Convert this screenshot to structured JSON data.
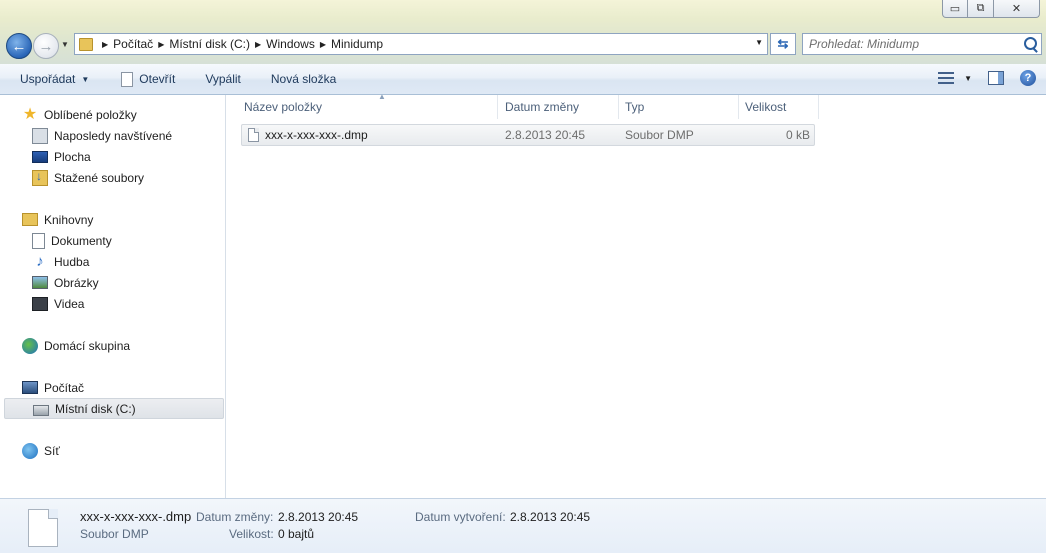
{
  "window": {
    "minimize_glyph": "▭",
    "maximize_glyph": "⧉",
    "close_glyph": "✕"
  },
  "nav": {
    "back_glyph": "←",
    "forward_glyph": "→",
    "recent_glyph": "▼"
  },
  "address": {
    "crumbs": [
      "Počítač",
      "Místní disk (C:)",
      "Windows",
      "Minidump"
    ]
  },
  "search": {
    "placeholder": "Prohledat: Minidump"
  },
  "toolbar": {
    "organize_label": "Uspořádat",
    "open_label": "Otevřít",
    "burn_label": "Vypálit",
    "new_folder_label": "Nová složka"
  },
  "navpane": {
    "favorites": "Oblíbené položky",
    "recent_places": "Naposledy navštívené",
    "desktop": "Plocha",
    "downloads": "Stažené soubory",
    "libraries": "Knihovny",
    "documents": "Dokumenty",
    "music": "Hudba",
    "pictures": "Obrázky",
    "videos": "Videa",
    "homegroup": "Domácí skupina",
    "computer": "Počítač",
    "local_disk": "Místní disk (C:)",
    "network": "Síť"
  },
  "columns": {
    "name": "Název položky",
    "date": "Datum změny",
    "type": "Typ",
    "size": "Velikost"
  },
  "files": [
    {
      "name": "xxx-x-xxx-xxx-.dmp",
      "date": "2.8.2013 20:45",
      "type": "Soubor DMP",
      "size": "0 kB"
    }
  ],
  "details": {
    "filename": "xxx-x-xxx-xxx-.dmp",
    "filetype": "Soubor DMP",
    "modified_label": "Datum změny:",
    "modified_value": "2.8.2013 20:45",
    "size_label": "Velikost:",
    "size_value": "0 bajtů",
    "created_label": "Datum vytvoření:",
    "created_value": "2.8.2013 20:45"
  }
}
